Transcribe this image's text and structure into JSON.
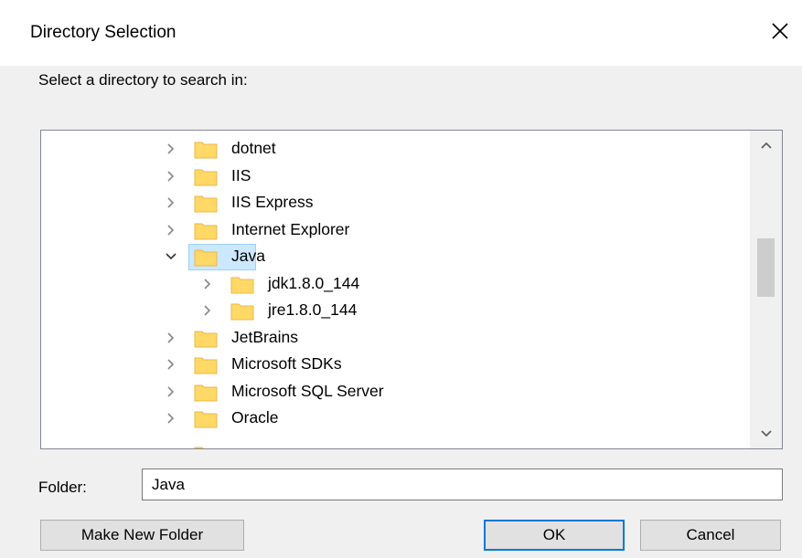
{
  "dialog": {
    "title": "Directory Selection",
    "close_label": "✕",
    "prompt": "Select a directory to search in:"
  },
  "tree": {
    "items": [
      {
        "label": "dotnet",
        "level": 0,
        "expanded": false,
        "selected": false
      },
      {
        "label": "IIS",
        "level": 0,
        "expanded": false,
        "selected": false
      },
      {
        "label": "IIS Express",
        "level": 0,
        "expanded": false,
        "selected": false
      },
      {
        "label": "Internet Explorer",
        "level": 0,
        "expanded": false,
        "selected": false
      },
      {
        "label": "Java",
        "level": 0,
        "expanded": true,
        "selected": true
      },
      {
        "label": "jdk1.8.0_144",
        "level": 1,
        "expanded": false,
        "selected": false
      },
      {
        "label": "jre1.8.0_144",
        "level": 1,
        "expanded": false,
        "selected": false
      },
      {
        "label": "JetBrains",
        "level": 0,
        "expanded": false,
        "selected": false
      },
      {
        "label": "Microsoft SDKs",
        "level": 0,
        "expanded": false,
        "selected": false
      },
      {
        "label": "Microsoft SQL Server",
        "level": 0,
        "expanded": false,
        "selected": false
      },
      {
        "label": "Oracle",
        "level": 0,
        "expanded": false,
        "selected": false
      }
    ],
    "icons": {
      "collapsed": "chevron-right-icon",
      "expanded": "chevron-down-icon",
      "folder": "folder-icon"
    }
  },
  "folder_field": {
    "label": "Folder:",
    "value": "Java"
  },
  "buttons": {
    "make_new_folder": "Make New Folder",
    "ok": "OK",
    "cancel": "Cancel"
  },
  "colors": {
    "selection_bg": "#cce8ff",
    "selection_border": "#99d1ff",
    "folder_fill": "#ffd866",
    "folder_edge": "#e8b84a",
    "default_button_border": "#0078d7"
  }
}
